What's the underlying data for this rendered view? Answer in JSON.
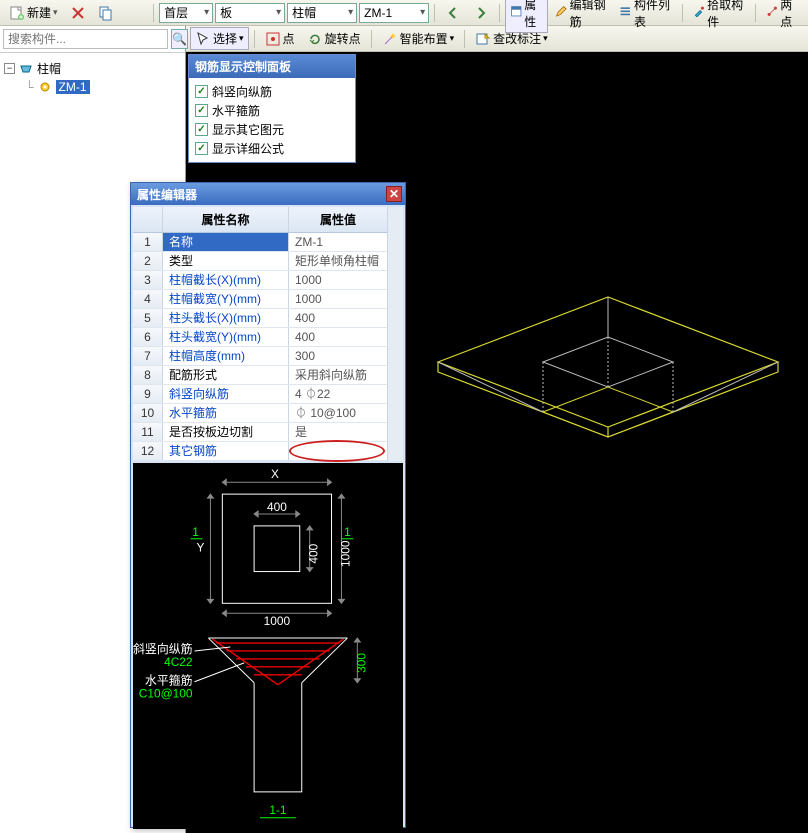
{
  "toolbar1": {
    "new_label": "新建",
    "floor_combo": "首层",
    "slab_combo": "板",
    "cap_combo": "柱帽",
    "zm_combo": "ZM-1",
    "prop_btn": "属性",
    "edit_rebar_btn": "编辑钢筋",
    "list_btn": "构件列表",
    "pick_btn": "拾取构件",
    "two_pt_btn": "两点"
  },
  "toolbar2": {
    "select_btn": "选择",
    "point_btn": "点",
    "rot_point_btn": "旋转点",
    "smart_layout_btn": "智能布置",
    "review_note_btn": "查改标注"
  },
  "search": {
    "placeholder": "搜索构件..."
  },
  "tree": {
    "root": "柱帽",
    "child": "ZM-1"
  },
  "rebar_panel": {
    "title": "钢筋显示控制面板",
    "items": [
      "斜竖向纵筋",
      "水平箍筋",
      "显示其它图元",
      "显示详细公式"
    ]
  },
  "prop_editor": {
    "title": "属性编辑器",
    "head_name": "属性名称",
    "head_val": "属性值",
    "rows": [
      {
        "n": "1",
        "name": "名称",
        "val": "ZM-1",
        "sel": true,
        "black": false
      },
      {
        "n": "2",
        "name": "类型",
        "val": "矩形单倾角柱帽",
        "black": true
      },
      {
        "n": "3",
        "name": "柱帽截长(X)(mm)",
        "val": "1000"
      },
      {
        "n": "4",
        "name": "柱帽截宽(Y)(mm)",
        "val": "1000"
      },
      {
        "n": "5",
        "name": "柱头截长(X)(mm)",
        "val": "400"
      },
      {
        "n": "6",
        "name": "柱头截宽(Y)(mm)",
        "val": "400"
      },
      {
        "n": "7",
        "name": "柱帽高度(mm)",
        "val": "300"
      },
      {
        "n": "8",
        "name": "配筋形式",
        "val": "采用斜向纵筋",
        "black": true
      },
      {
        "n": "9",
        "name": "斜竖向纵筋",
        "val": "4 ⏀22"
      },
      {
        "n": "10",
        "name": "水平箍筋",
        "val": "⏀ 10@100"
      },
      {
        "n": "11",
        "name": "是否按板边切割",
        "val": "是",
        "black": true
      },
      {
        "n": "12",
        "name": "其它钢筋",
        "val": "",
        "ellipse": true
      }
    ]
  },
  "diagram": {
    "top_X": "X",
    "top_400": "400",
    "left_Y": "Y",
    "side_1": "1",
    "v_400": "400",
    "v_1000": "1000",
    "h_1000": "1000",
    "label_diag": "斜竖向纵筋",
    "label_diag_val": "4C22",
    "label_hoop": "水平箍筋",
    "label_hoop_val": "C10@100",
    "v_300": "300",
    "section": "1-1"
  }
}
